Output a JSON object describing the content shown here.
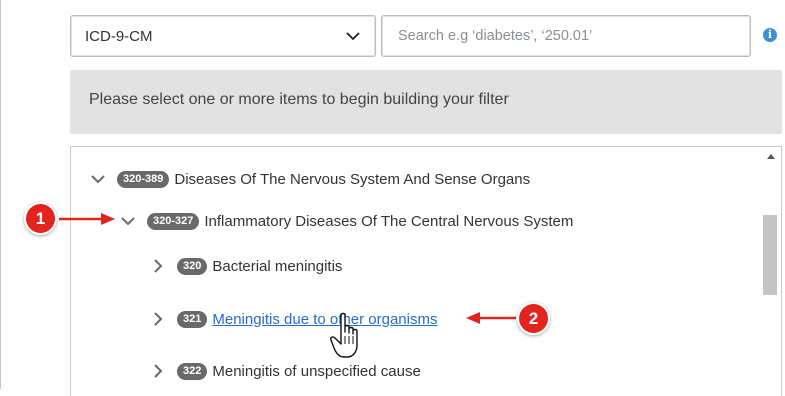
{
  "code_system": {
    "selected": "ICD-9-CM"
  },
  "search": {
    "placeholder": "Search e.g ‘diabetes’, ‘250.01’"
  },
  "banner": {
    "text": "Please select one or more items to begin building your filter"
  },
  "tree": [
    {
      "code": "320-389",
      "label": "Diseases Of The Nervous System And Sense Organs",
      "expanded": true
    },
    {
      "code": "320-327",
      "label": "Inflammatory Diseases Of The Central Nervous System",
      "expanded": true
    },
    {
      "code": "320",
      "label": "Bacterial meningitis",
      "expanded": false
    },
    {
      "code": "321",
      "label": "Meningitis due to other organisms",
      "expanded": false,
      "hovered": true
    },
    {
      "code": "322",
      "label": "Meningitis of unspecified cause",
      "expanded": false
    }
  ],
  "callouts": [
    {
      "number": "1"
    },
    {
      "number": "2"
    }
  ],
  "colors": {
    "callout": "#e3231e",
    "badge": "#696969",
    "link": "#2b6cc4",
    "banner": "#e2e2e2"
  }
}
